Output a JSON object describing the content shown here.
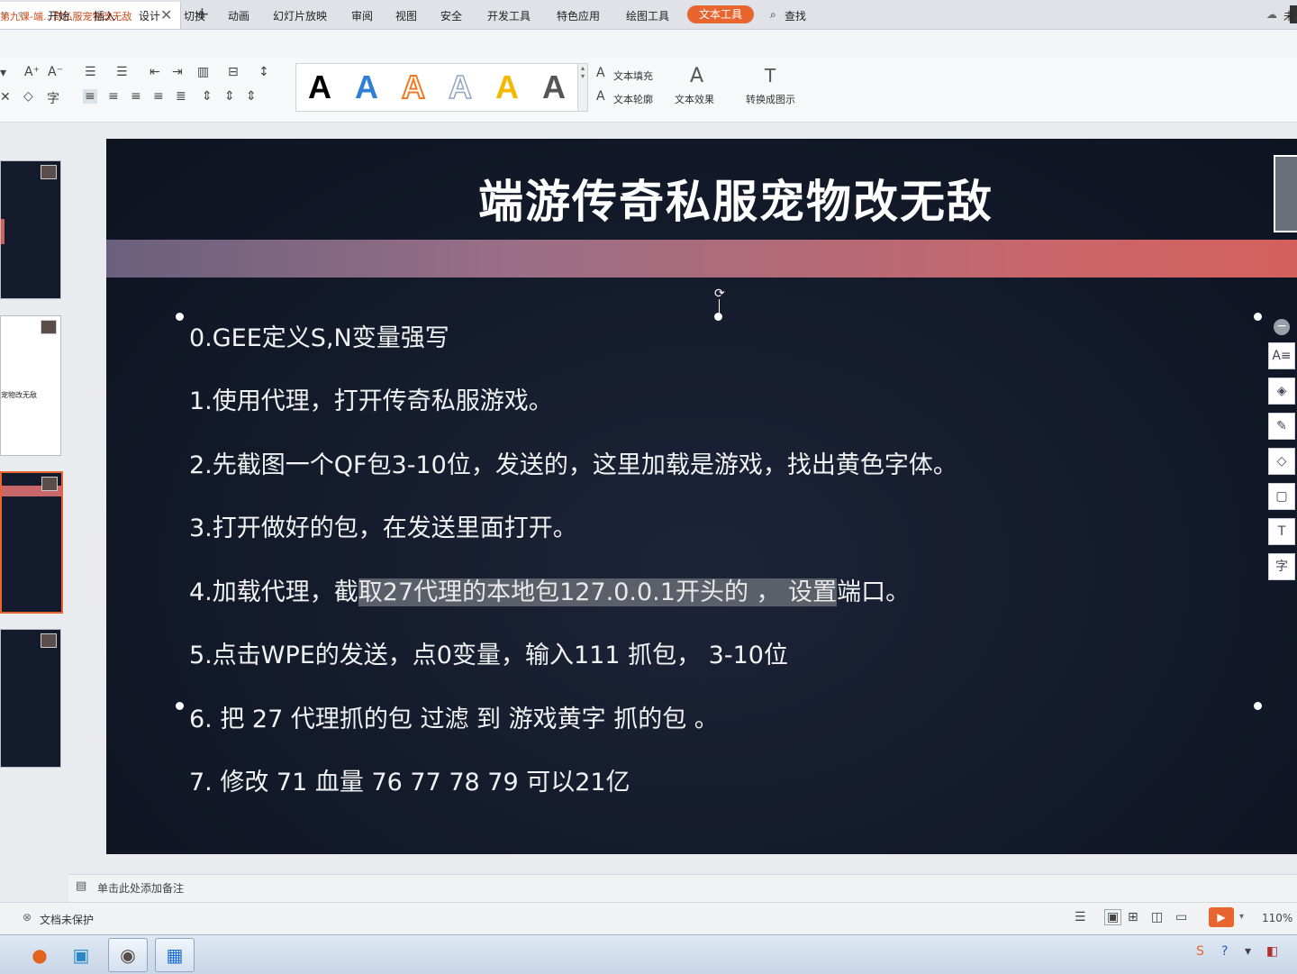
{
  "window": {
    "tab_title": "第九课-端...奇私服宠物改无敌",
    "tab_close": "✕",
    "new_tab": "+"
  },
  "menu": {
    "items": [
      "开始",
      "插入",
      "设计",
      "切换",
      "动画",
      "幻灯片放映",
      "审阅",
      "视图",
      "安全",
      "开发工具",
      "特色应用",
      "绘图工具"
    ],
    "active": "文本工具",
    "search": "查找",
    "sync": "未"
  },
  "ribbon": {
    "text_fill": "文本填充",
    "text_outline": "文本轮廓",
    "text_effects": "文本效果",
    "convert_graphic": "转换成图示",
    "style_letter": "A",
    "style_colors": [
      "#000000",
      "#2f7fd6",
      "#f07b22",
      "#8fa6c8",
      "#f5b800",
      "#555555"
    ]
  },
  "slide": {
    "title": "端游传奇私服宠物改无敌",
    "lines": [
      {
        "text": "0.GEE定义S,N变量强写"
      },
      {
        "text": "1.使用代理，打开传奇私服游戏。"
      },
      {
        "text": "2.先截图一个QF包3-10位，发送的，这里加载是游戏，找出黄色字体。"
      },
      {
        "text": "3.打开做好的包，在发送里面打开。"
      },
      {
        "pre": "4.加载代理，截",
        "highlight": "取27代理的本地包127.0.0.1开头的 ，  设置",
        "post": "端口。"
      },
      {
        "text": "5.点击WPE的发送，点0变量，输入111  抓包，  3-10位"
      },
      {
        "text": "6.  把  27  代理抓的包  过滤  到    游戏黄字  抓的包  。"
      },
      {
        "text": "7.  修改  71  血量  76  77  78  79       可以21亿"
      }
    ]
  },
  "thumbnails": {
    "thumb2_text": "宠物改无敌"
  },
  "notes": {
    "placeholder": "单击此处添加备注"
  },
  "status": {
    "doc_protect": "文档未保护",
    "zoom": "110%"
  }
}
